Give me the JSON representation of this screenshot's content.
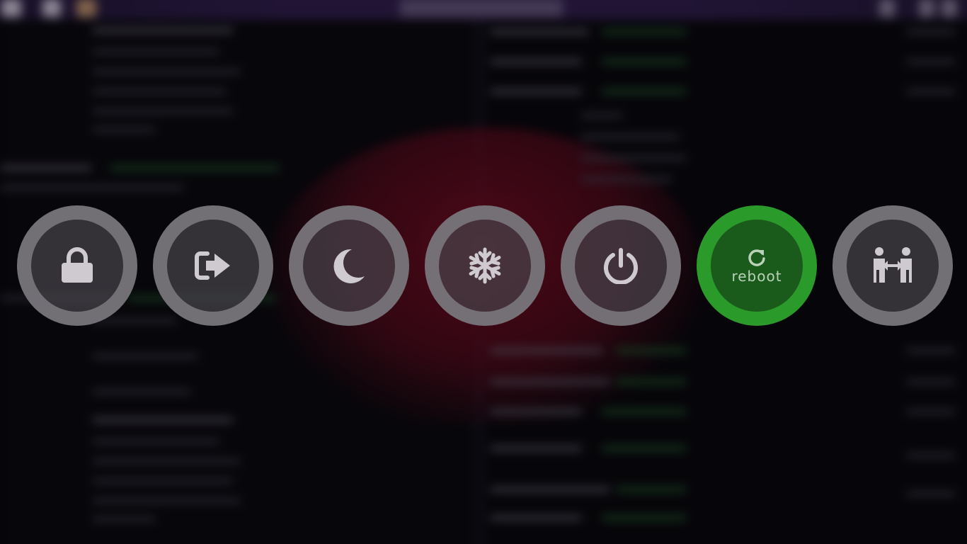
{
  "power_menu": {
    "options": [
      {
        "id": "lock",
        "icon": "lock-icon",
        "label": ""
      },
      {
        "id": "logout",
        "icon": "logout-icon",
        "label": ""
      },
      {
        "id": "suspend",
        "icon": "moon-icon",
        "label": ""
      },
      {
        "id": "hibernate",
        "icon": "snowflake-icon",
        "label": ""
      },
      {
        "id": "shutdown",
        "icon": "power-icon",
        "label": ""
      },
      {
        "id": "reboot",
        "icon": "refresh-icon",
        "label": "reboot"
      },
      {
        "id": "switch-user",
        "icon": "switch-user-icon",
        "label": ""
      }
    ],
    "selected": "reboot"
  },
  "colors": {
    "option_ring": "#807e84",
    "option_fill": "#46424a",
    "selected_ring": "#2a9a2a",
    "selected_fill": "#1a5a1a",
    "icon": "#cfcacf"
  }
}
